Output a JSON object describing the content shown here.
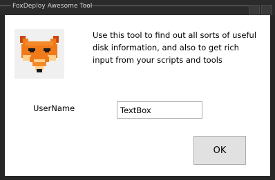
{
  "window": {
    "title": "FoxDeploy Awesome Tool"
  },
  "logo": {
    "icon": "fox-face-icon"
  },
  "description": "Use this tool to find out all sorts of useful disk information, and also to get rich input from your scripts and tools",
  "form": {
    "username_label": "UserName",
    "username_value": "TextBox"
  },
  "actions": {
    "ok_label": "OK"
  },
  "colors": {
    "fox_orange": "#f07a1a",
    "fox_dark": "#c84a10",
    "fox_light": "#ffd08a"
  }
}
